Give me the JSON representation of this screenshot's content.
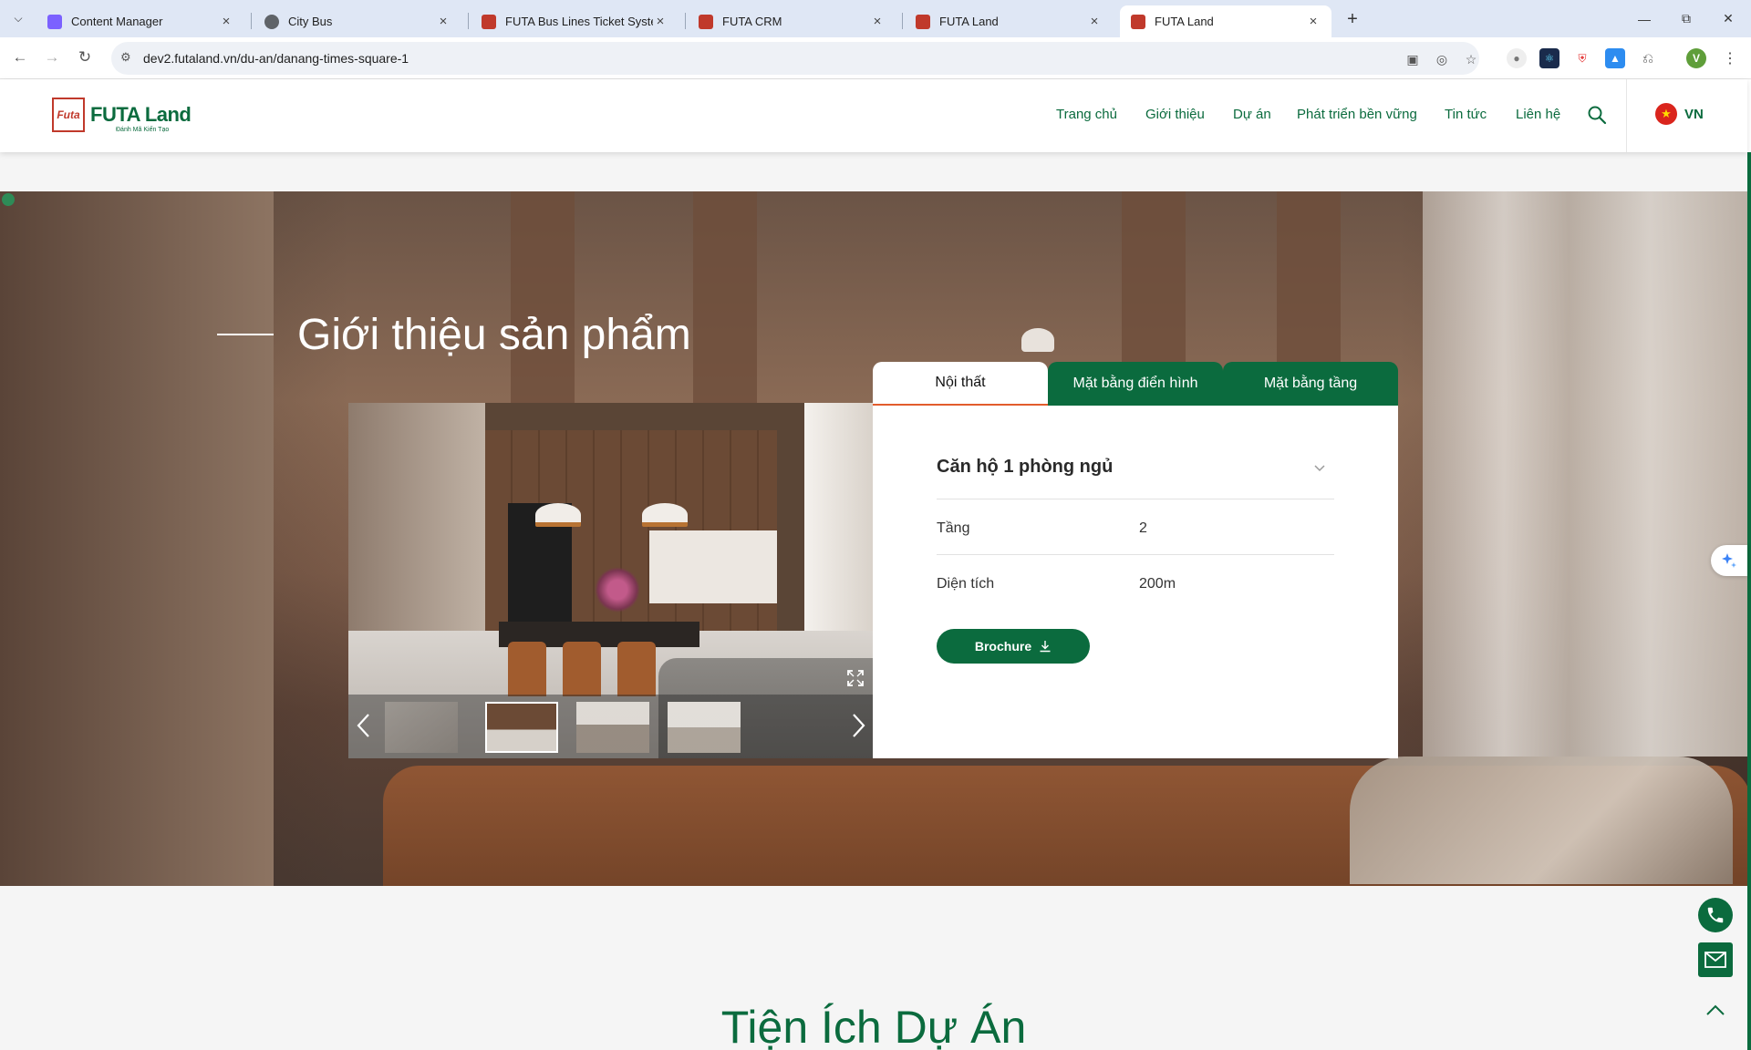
{
  "browser": {
    "tabs": [
      {
        "title": "Content Manager",
        "color": "#7b61ff"
      },
      {
        "title": "City Bus",
        "color": "#5f6368"
      },
      {
        "title": "FUTA Bus Lines Ticket System",
        "color": "#c0392b"
      },
      {
        "title": "FUTA CRM",
        "color": "#c0392b"
      },
      {
        "title": "FUTA Land",
        "color": "#c0392b"
      },
      {
        "title": "FUTA Land",
        "color": "#c0392b",
        "active": true
      }
    ],
    "url": "dev2.futaland.vn/du-an/danang-times-square-1",
    "profile_initial": "V"
  },
  "header": {
    "logo_text": "FUTA Land",
    "logo_mark": "Futa",
    "logo_tagline": "Đánh Mã Kiến Tạo",
    "nav": [
      "Trang chủ",
      "Giới thiệu",
      "Dự án",
      "Phát triển bền vững",
      "Tin tức",
      "Liên hệ"
    ],
    "language": "VN"
  },
  "section": {
    "title": "Giới thiệu sản phẩm",
    "tabs": [
      "Nội thất",
      "Mặt bằng điển hình",
      "Mặt bằng tầng"
    ],
    "active_tab": 0
  },
  "unit": {
    "name": "Căn hộ 1 phòng ngủ",
    "rows": [
      {
        "label": "Tầng",
        "value": "2"
      },
      {
        "label": "Diện tích",
        "value": "200m"
      }
    ],
    "brochure_label": "Brochure"
  },
  "amenities": {
    "title": "Tiện Ích Dự Án"
  },
  "colors": {
    "brand_green": "#0b6b3e",
    "tab_active_underline": "#e25c2c"
  }
}
